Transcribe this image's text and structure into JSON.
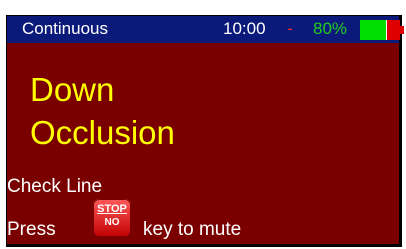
{
  "status": {
    "mode": "Continuous",
    "time": "10:00",
    "separator": "-",
    "battery_percent": "80%",
    "battery_level": 0.8
  },
  "alarm": {
    "line1": "Down",
    "line2": "Occlusion"
  },
  "info": {
    "check": "Check Line",
    "press": "Press",
    "mute_suffix": "key to mute"
  },
  "stop_key": {
    "top": "STOP",
    "bottom": "NO"
  },
  "colors": {
    "status_bg": "#0b1a7a",
    "alarm_bg": "#7a0000",
    "alarm_text": "#ffff00",
    "battery_pct_text": "#22cc22",
    "separator_text": "#ff2a2a"
  }
}
